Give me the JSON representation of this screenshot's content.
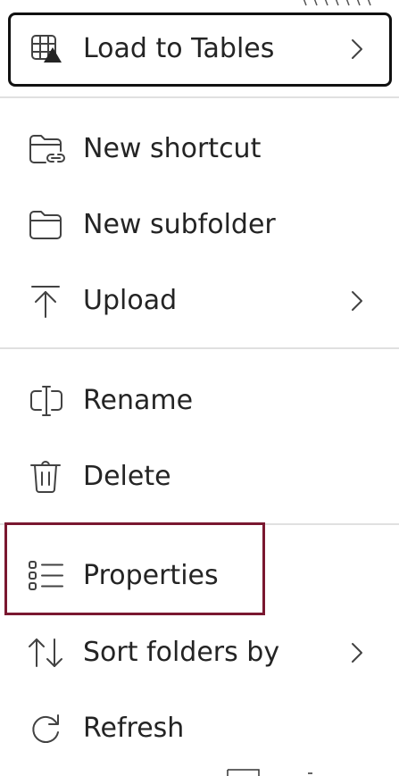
{
  "menu": {
    "items": [
      {
        "label": "Load to Tables",
        "icon": "table-load-icon",
        "has_submenu": true
      },
      {
        "label": "New shortcut",
        "icon": "folder-link-icon",
        "has_submenu": false
      },
      {
        "label": "New subfolder",
        "icon": "folder-icon",
        "has_submenu": false
      },
      {
        "label": "Upload",
        "icon": "upload-icon",
        "has_submenu": true
      },
      {
        "label": "Rename",
        "icon": "rename-icon",
        "has_submenu": false
      },
      {
        "label": "Delete",
        "icon": "trash-icon",
        "has_submenu": false
      },
      {
        "label": "Properties",
        "icon": "properties-list-icon",
        "has_submenu": false
      },
      {
        "label": "Sort folders by",
        "icon": "sort-arrows-icon",
        "has_submenu": true
      },
      {
        "label": "Refresh",
        "icon": "refresh-icon",
        "has_submenu": false
      }
    ],
    "focused_item": "Load to Tables",
    "highlighted_item": "Properties"
  },
  "colors": {
    "text": "#242424",
    "icon": "#424242",
    "divider": "#e0e0e0",
    "focus_border": "#111111",
    "highlight_border": "#7a1830",
    "background": "#ffffff"
  }
}
